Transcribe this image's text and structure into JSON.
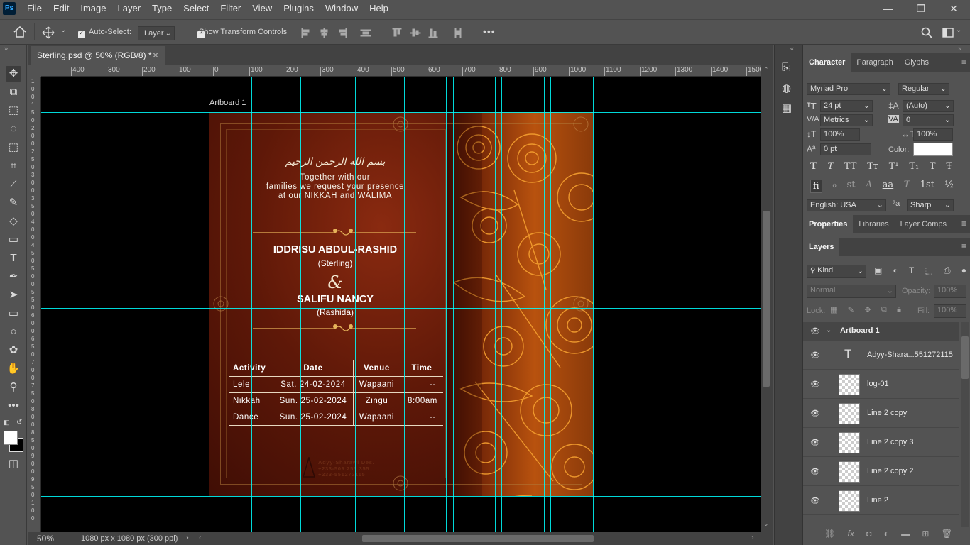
{
  "app": {
    "logo": "Ps"
  },
  "menu": [
    "File",
    "Edit",
    "Image",
    "Layer",
    "Type",
    "Select",
    "Filter",
    "View",
    "Plugins",
    "Window",
    "Help"
  ],
  "options": {
    "auto_select_label": "Auto-Select:",
    "auto_select_value": "Layer",
    "transform_label": "Show Transform Controls"
  },
  "document": {
    "tab_title": "Sterling.psd @ 50% (RGB/8) *",
    "zoom": "50%",
    "info": "1080 px x 1080 px (300 ppi)"
  },
  "rulers": {
    "h": [
      "400",
      "300",
      "200",
      "100",
      "0",
      "100",
      "200",
      "300",
      "400",
      "500",
      "600",
      "700",
      "800",
      "900",
      "1000",
      "1100",
      "1200",
      "1300",
      "1400",
      "1500"
    ],
    "v": [
      "1",
      "0",
      "0",
      "1",
      "5",
      "0",
      "2",
      "0",
      "0",
      "2",
      "5",
      "0",
      "3",
      "0",
      "0",
      "3",
      "5",
      "0",
      "4",
      "0",
      "0",
      "4",
      "5",
      "0",
      "5",
      "0",
      "0",
      "5",
      "5",
      "0",
      "6",
      "0",
      "0",
      "6",
      "5",
      "0",
      "7",
      "0",
      "0",
      "7",
      "5",
      "0",
      "8",
      "0",
      "0",
      "8",
      "5",
      "0",
      "9",
      "0",
      "0",
      "9",
      "5",
      "0",
      "1",
      "0",
      "0"
    ]
  },
  "artwork": {
    "artboard_label": "Artboard 1",
    "arabic": "بسم الله الرحمن الرحيم",
    "intro_lines": [
      "Together with our",
      "families we request your presence",
      "at our NIKKAH and WALIMA"
    ],
    "groom_name": "IDDRISU ABDUL-RASHID",
    "groom_nick": "(Sterling)",
    "ampersand": "&",
    "bride_name": "SALIFU NANCY",
    "bride_nick": "(Rashida)",
    "table_headers": [
      "Activity",
      "Date",
      "Venue",
      "Time"
    ],
    "table_rows": [
      [
        "Lele",
        "Sat. 24-02-2024",
        "Wapaani",
        "--"
      ],
      [
        "Nikkah",
        "Sun. 25-02-2024",
        "Zingu",
        "8:00am"
      ],
      [
        "Dance",
        "Sun. 25-02-2024",
        "Wapaani",
        "--"
      ]
    ],
    "credit_lines": [
      "Adyy-Sharawi Des.",
      "+233-509 255 355",
      "+233-551272115"
    ],
    "colors": {
      "bg": "#5a1a0a",
      "gold": "#e6b35a",
      "orange": "#f08a1c"
    }
  },
  "character": {
    "tabs": [
      "Character",
      "Paragraph",
      "Glyphs"
    ],
    "font_family": "Myriad Pro",
    "font_style": "Regular",
    "size": "24 pt",
    "leading": "(Auto)",
    "kerning": "Metrics",
    "tracking": "0",
    "vscale": "100%",
    "hscale": "100%",
    "baseline": "0 pt",
    "color_label": "Color:",
    "style_buttons": [
      "T",
      "T",
      "TT",
      "Tт",
      "T¹",
      "T₁",
      "T",
      "Ŧ"
    ],
    "ot_buttons": [
      "fi",
      "ℴ",
      "st",
      "A",
      "aa",
      "T",
      "1st",
      "½"
    ],
    "language": "English: USA",
    "aa_label": "ªa",
    "antialias": "Sharp"
  },
  "props_tabs": [
    "Properties",
    "Libraries",
    "Layer Comps"
  ],
  "layers": {
    "tab": "Layers",
    "filter": "Kind",
    "blend": "Normal",
    "opacity_label": "Opacity:",
    "opacity": "100%",
    "lock_label": "Lock:",
    "fill_label": "Fill:",
    "fill": "100%",
    "artboard": "Artboard 1",
    "items": [
      "Adyy-Shara...551272115",
      "log-01",
      "Line 2 copy",
      "Line 2 copy 3",
      "Line 2 copy 2",
      "Line 2"
    ]
  }
}
